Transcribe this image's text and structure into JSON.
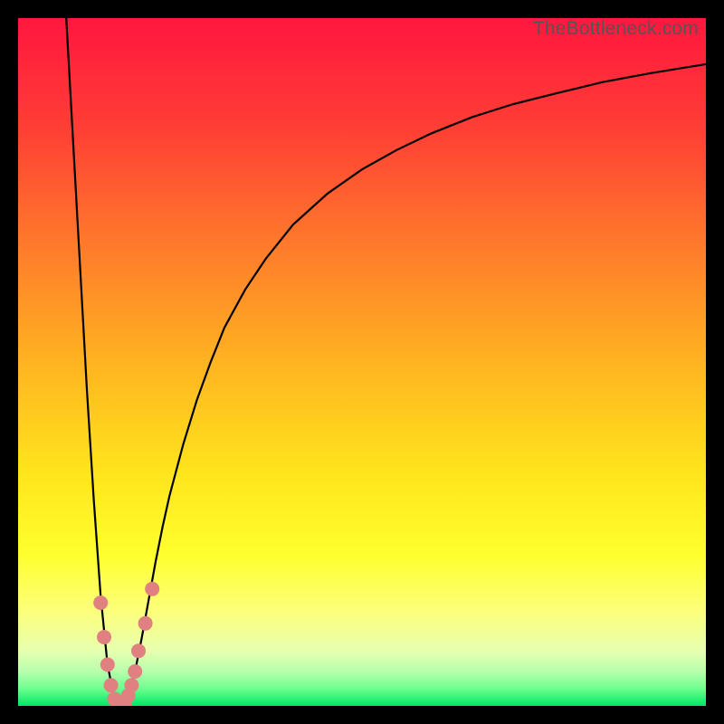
{
  "meta": {
    "watermark": "TheBottleneck.com"
  },
  "style": {
    "black": "#000000",
    "gradient_stops": [
      {
        "offset": 0.0,
        "color": "#ff173f"
      },
      {
        "offset": 0.16,
        "color": "#ff3e35"
      },
      {
        "offset": 0.33,
        "color": "#ff7a2b"
      },
      {
        "offset": 0.5,
        "color": "#ffb321"
      },
      {
        "offset": 0.66,
        "color": "#ffe41c"
      },
      {
        "offset": 0.78,
        "color": "#ffff2e"
      },
      {
        "offset": 0.86,
        "color": "#fdff79"
      },
      {
        "offset": 0.92,
        "color": "#e7ffb0"
      },
      {
        "offset": 0.95,
        "color": "#b8ffac"
      },
      {
        "offset": 0.975,
        "color": "#6dff8e"
      },
      {
        "offset": 1.0,
        "color": "#00e765"
      }
    ],
    "curve_color": "#000000",
    "curve_width": 2.2,
    "marker_color": "#e08080",
    "marker_radius": 8
  },
  "chart_data": {
    "type": "line",
    "title": "",
    "xlabel": "",
    "ylabel": "",
    "xlim": [
      0,
      100
    ],
    "ylim": [
      0,
      100
    ],
    "grid": false,
    "legend": false,
    "series": [
      {
        "name": "bottleneck-curve",
        "x": [
          7.0,
          8.0,
          9.0,
          10.0,
          11.0,
          12.0,
          13.0,
          14.0,
          15.0,
          16.0,
          17.0,
          18.0,
          19.0,
          20.0,
          21.0,
          22.0,
          24.0,
          26.0,
          28.0,
          30.0,
          33.0,
          36.0,
          40.0,
          45.0,
          50.0,
          55.0,
          60.0,
          66.0,
          72.0,
          78.0,
          85.0,
          92.0,
          100.0
        ],
        "y": [
          100.0,
          82.0,
          64.0,
          46.0,
          30.0,
          16.0,
          6.0,
          1.0,
          0.0,
          1.5,
          5.0,
          10.0,
          15.5,
          21.0,
          26.0,
          30.5,
          38.0,
          44.5,
          50.0,
          55.0,
          60.5,
          65.0,
          70.0,
          74.5,
          78.0,
          80.8,
          83.2,
          85.6,
          87.5,
          89.0,
          90.7,
          92.0,
          93.3
        ]
      }
    ],
    "markers": {
      "name": "data-points",
      "color": "#e08080",
      "x": [
        12.0,
        12.5,
        13.0,
        13.5,
        14.0,
        14.5,
        15.0,
        15.5,
        16.0,
        16.5,
        17.0,
        17.5,
        18.5,
        19.5
      ],
      "y": [
        15.0,
        10.0,
        6.0,
        3.0,
        1.0,
        0.3,
        0.0,
        0.5,
        1.5,
        3.0,
        5.0,
        8.0,
        12.0,
        17.0
      ]
    }
  }
}
